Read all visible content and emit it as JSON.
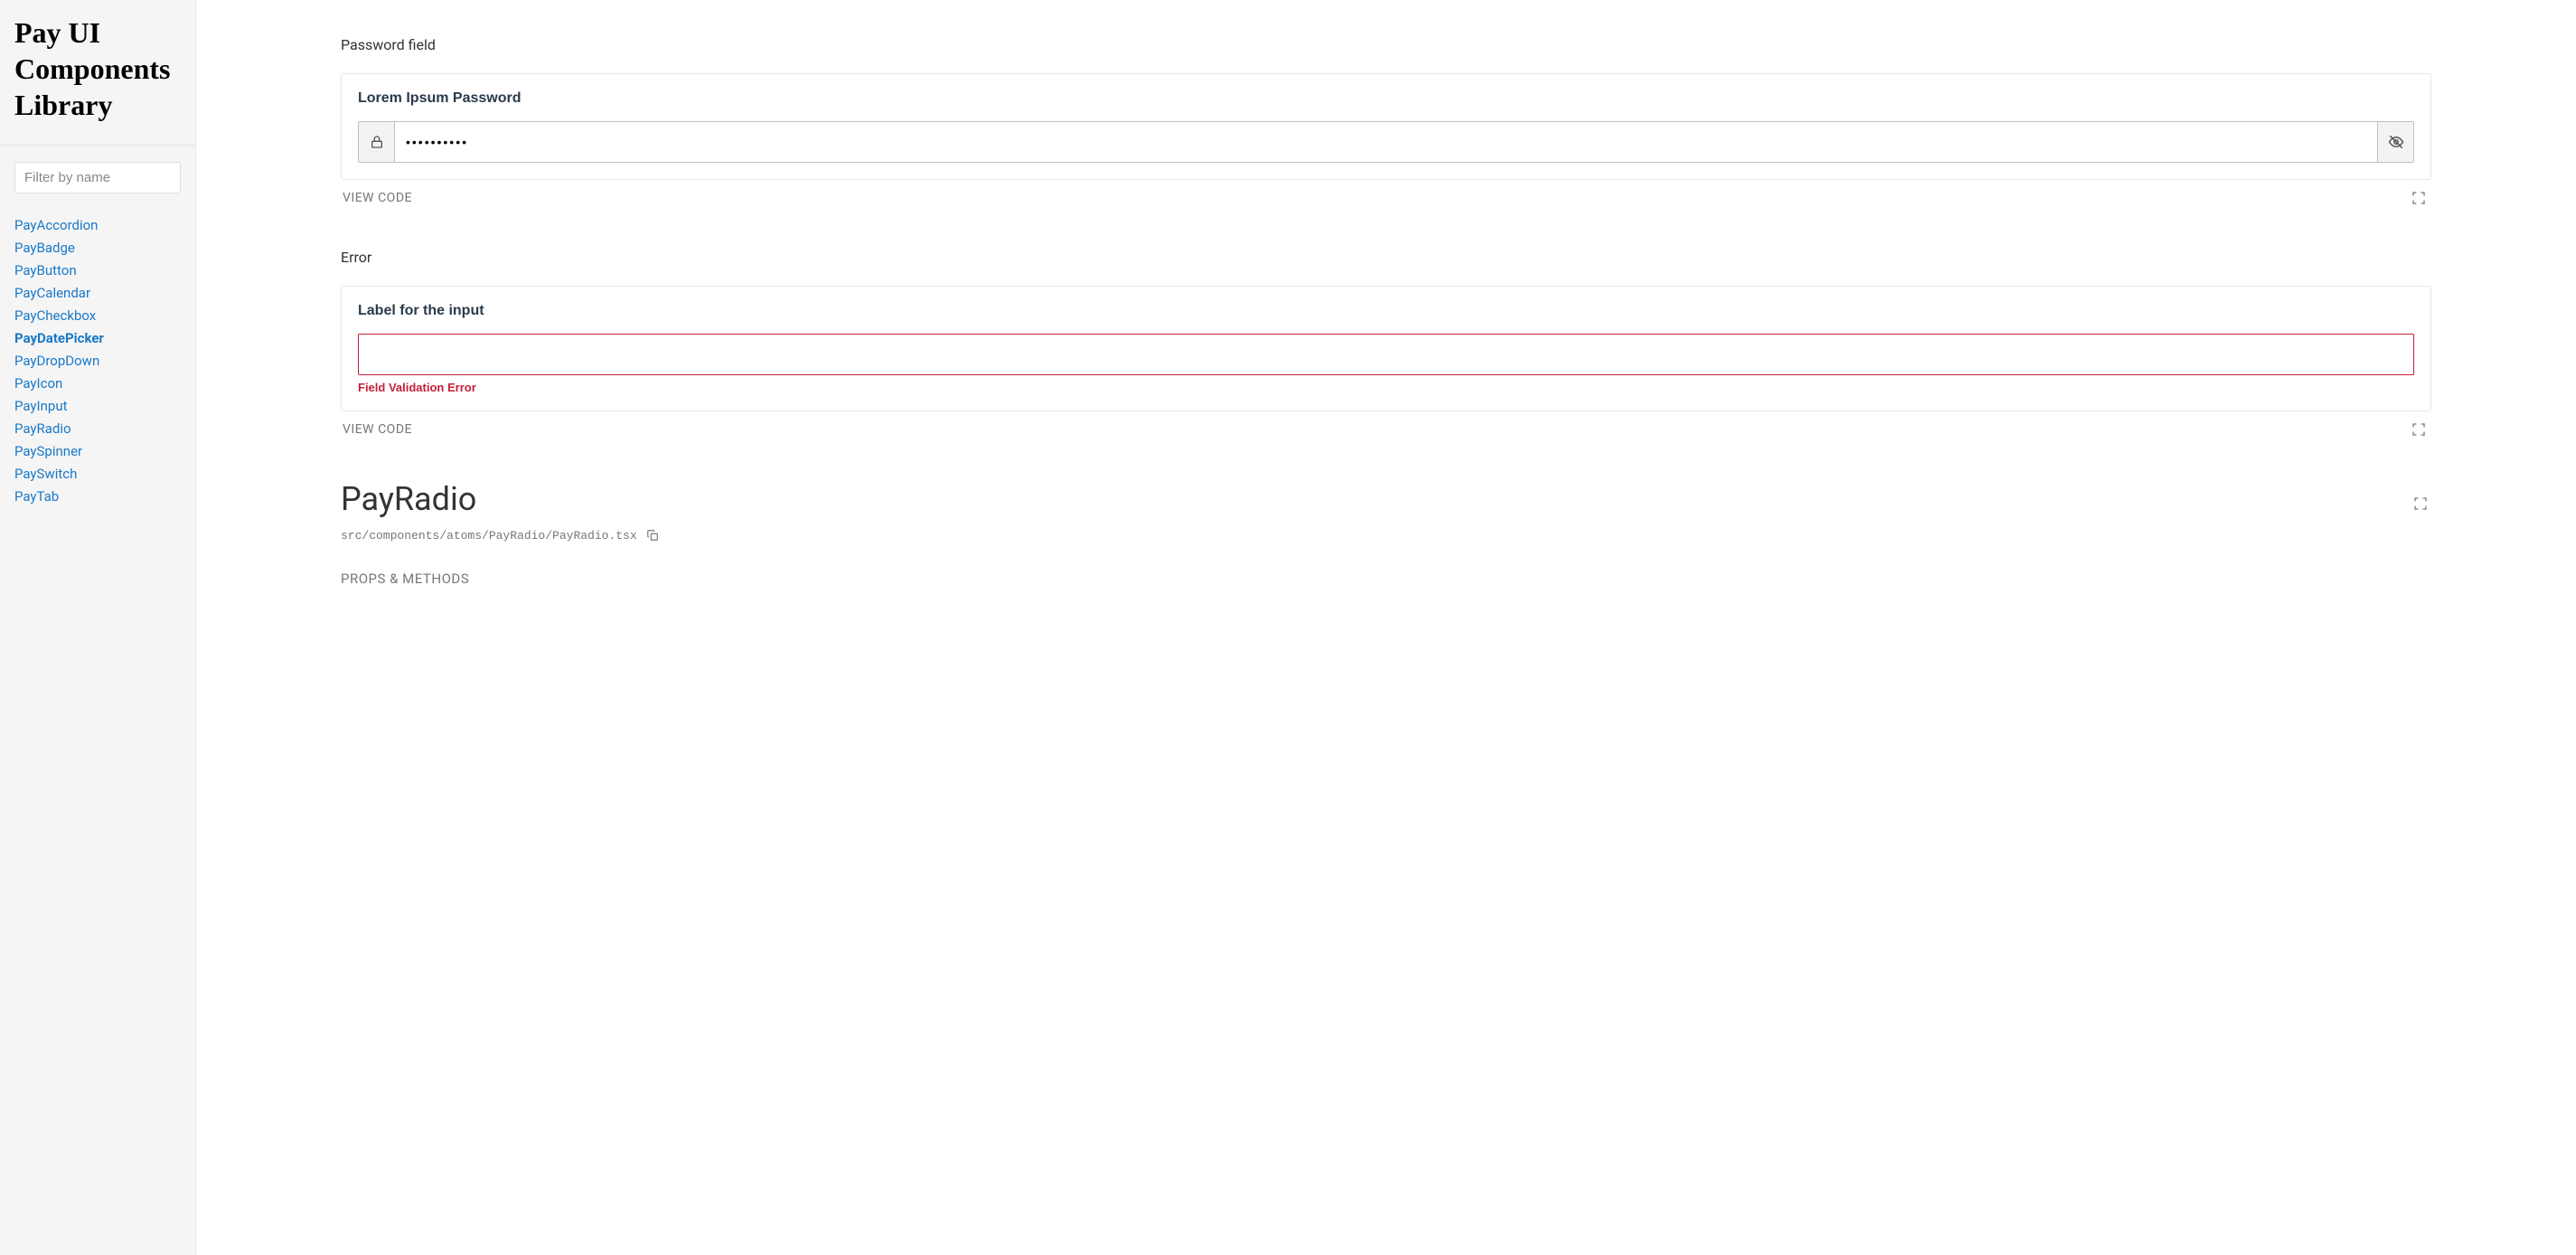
{
  "sidebar": {
    "title": "Pay UI Components Library",
    "filter_placeholder": "Filter by name",
    "items": [
      {
        "label": "PayAccordion",
        "active": false
      },
      {
        "label": "PayBadge",
        "active": false
      },
      {
        "label": "PayButton",
        "active": false
      },
      {
        "label": "PayCalendar",
        "active": false
      },
      {
        "label": "PayCheckbox",
        "active": false
      },
      {
        "label": "PayDatePicker",
        "active": true
      },
      {
        "label": "PayDropDown",
        "active": false
      },
      {
        "label": "PayIcon",
        "active": false
      },
      {
        "label": "PayInput",
        "active": false
      },
      {
        "label": "PayRadio",
        "active": false
      },
      {
        "label": "PaySpinner",
        "active": false
      },
      {
        "label": "PaySwitch",
        "active": false
      },
      {
        "label": "PayTab",
        "active": false
      }
    ]
  },
  "examples": {
    "password": {
      "section_label": "Password field",
      "field_label": "Lorem Ipsum Password",
      "value": "••••••••••",
      "view_code": "VIEW CODE"
    },
    "error": {
      "section_label": "Error",
      "field_label": "Label for the input",
      "error_message": "Field Validation Error",
      "view_code": "VIEW CODE"
    }
  },
  "component": {
    "title": "PayRadio",
    "src_path": "src/components/atoms/PayRadio/PayRadio.tsx",
    "props_heading": "PROPS & METHODS"
  }
}
